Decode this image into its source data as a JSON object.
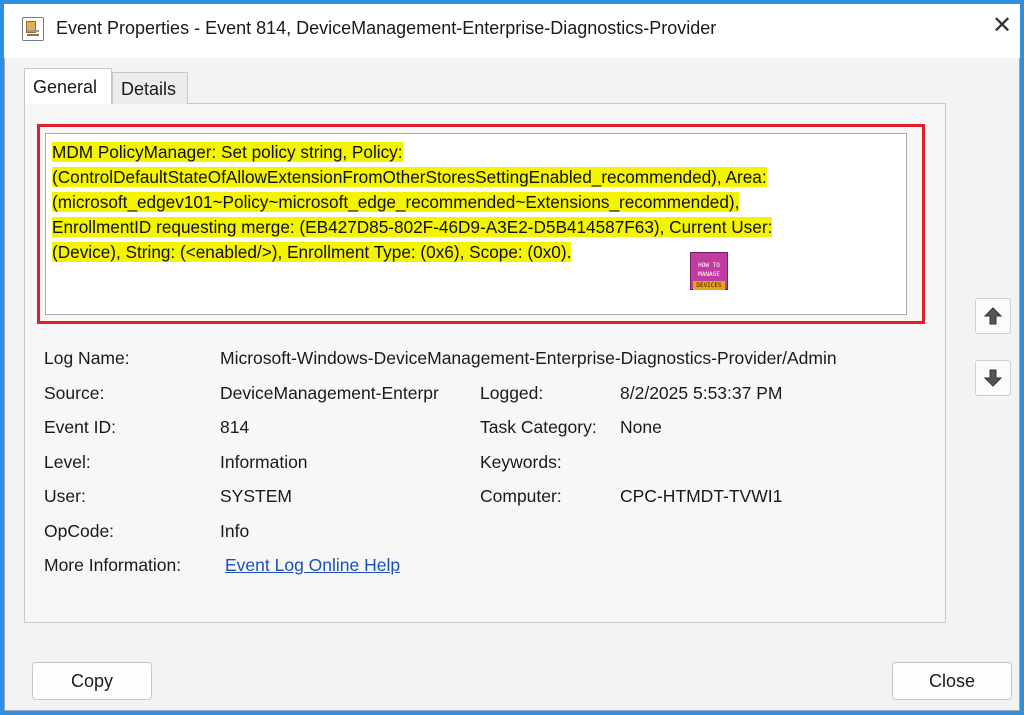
{
  "window": {
    "title": "Event Properties - Event 814, DeviceManagement-Enterprise-Diagnostics-Provider",
    "close_glyph": "✕"
  },
  "tabs": [
    {
      "label": "General",
      "active": true
    },
    {
      "label": "Details",
      "active": false
    }
  ],
  "description": {
    "lines": [
      "MDM PolicyManager: Set policy string, Policy:",
      "(ControlDefaultStateOfAllowExtensionFromOtherStoresSettingEnabled_recommended), Area:",
      "(microsoft_edgev101~Policy~microsoft_edge_recommended~Extensions_recommended),",
      "EnrollmentID requesting merge: (EB427D85-802F-46D9-A3E2-D5B414587F63), Current User:",
      "(Device), String: (<enabled/>), Enrollment Type: (0x6), Scope: (0x0)."
    ],
    "highlight_color": "#f4f400",
    "frame_color": "#e0202a"
  },
  "watermark": {
    "top": "HOW TO",
    "mid": "MANAGE",
    "bot": "DEVICES"
  },
  "fields": {
    "log_name_label": "Log Name:",
    "log_name_value": "Microsoft-Windows-DeviceManagement-Enterprise-Diagnostics-Provider/Admin",
    "source_label": "Source:",
    "source_value": "DeviceManagement-Enterpr",
    "logged_label": "Logged:",
    "logged_value": "8/2/2025 5:53:37 PM",
    "event_id_label": "Event ID:",
    "event_id_value": "814",
    "task_category_label": "Task Category:",
    "task_category_value": "None",
    "level_label": "Level:",
    "level_value": "Information",
    "keywords_label": "Keywords:",
    "keywords_value": "",
    "user_label": "User:",
    "user_value": "SYSTEM",
    "computer_label": "Computer:",
    "computer_value": "CPC-HTMDT-TVWI1",
    "opcode_label": "OpCode:",
    "opcode_value": "Info",
    "more_info_label": "More Information:",
    "more_info_link": "Event Log Online Help"
  },
  "buttons": {
    "copy": "Copy",
    "close": "Close"
  },
  "icons": {
    "app": "event-viewer-icon",
    "close": "close-icon",
    "up": "arrow-up-icon",
    "down": "arrow-down-icon"
  }
}
